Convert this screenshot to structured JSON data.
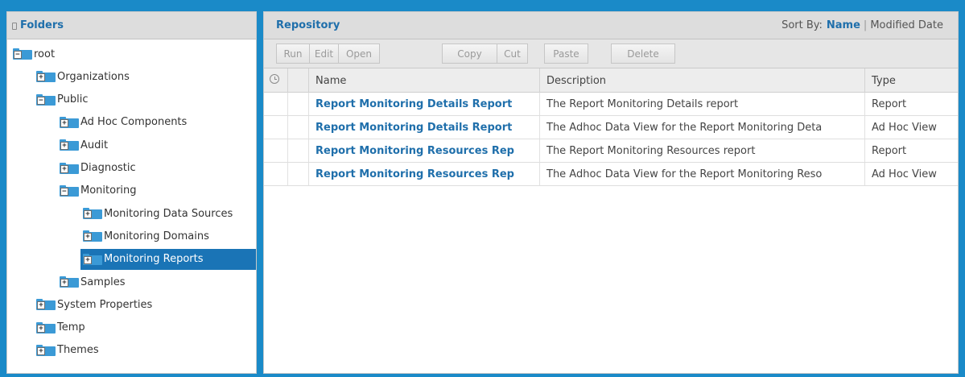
{
  "folders": {
    "title": "Folders",
    "tree": [
      {
        "label": "root",
        "toggle": "−",
        "depth": 0,
        "selected": false
      },
      {
        "label": "Organizations",
        "toggle": "+",
        "depth": 1,
        "selected": false
      },
      {
        "label": "Public",
        "toggle": "−",
        "depth": 1,
        "selected": false
      },
      {
        "label": "Ad Hoc Components",
        "toggle": "+",
        "depth": 2,
        "selected": false
      },
      {
        "label": "Audit",
        "toggle": "+",
        "depth": 2,
        "selected": false
      },
      {
        "label": "Diagnostic",
        "toggle": "+",
        "depth": 2,
        "selected": false
      },
      {
        "label": "Monitoring",
        "toggle": "−",
        "depth": 2,
        "selected": false
      },
      {
        "label": "Monitoring Data Sources",
        "toggle": "+",
        "depth": 3,
        "selected": false
      },
      {
        "label": "Monitoring Domains",
        "toggle": "+",
        "depth": 3,
        "selected": false
      },
      {
        "label": "Monitoring Reports",
        "toggle": "+",
        "depth": 3,
        "selected": true
      },
      {
        "label": "Samples",
        "toggle": "+",
        "depth": 2,
        "selected": false
      },
      {
        "label": "System Properties",
        "toggle": "+",
        "depth": 1,
        "selected": false
      },
      {
        "label": "Temp",
        "toggle": "+",
        "depth": 1,
        "selected": false
      },
      {
        "label": "Themes",
        "toggle": "+",
        "depth": 1,
        "selected": false
      }
    ]
  },
  "repository": {
    "title": "Repository",
    "sort": {
      "label": "Sort By:",
      "active": "Name",
      "other": "Modified Date"
    },
    "toolbar": {
      "run": "Run",
      "edit": "Edit",
      "open": "Open",
      "copy": "Copy",
      "cut": "Cut",
      "paste": "Paste",
      "delete": "Delete"
    },
    "columns": {
      "name": "Name",
      "description": "Description",
      "type": "Type"
    },
    "rows": [
      {
        "name": "Report Monitoring Details Report",
        "description": "The Report Monitoring Details report",
        "type": "Report"
      },
      {
        "name": "Report Monitoring Details Report",
        "description": "The Adhoc Data View for the Report Monitoring Deta",
        "type": "Ad Hoc View"
      },
      {
        "name": "Report Monitoring Resources Rep",
        "description": "The Report Monitoring Resources report",
        "type": "Report"
      },
      {
        "name": "Report Monitoring Resources Rep",
        "description": "The Adhoc Data View for the Report Monitoring Reso",
        "type": "Ad Hoc View"
      }
    ]
  },
  "colors": {
    "frame": "#1a8ac8",
    "accent": "#1f6fab",
    "selected": "#1a74b6",
    "folder": "#3b9ad6"
  }
}
